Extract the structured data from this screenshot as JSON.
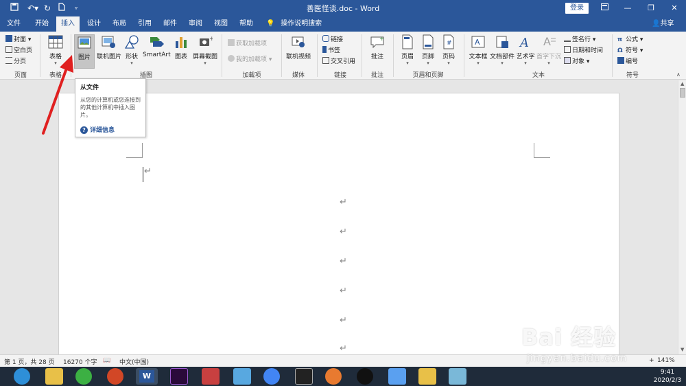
{
  "window": {
    "title": "善医怪谈.doc - Word",
    "login_label": "登录"
  },
  "tabs": [
    "文件",
    "开始",
    "插入",
    "设计",
    "布局",
    "引用",
    "邮件",
    "审阅",
    "视图",
    "帮助"
  ],
  "active_tab": "插入",
  "tellme": "操作说明搜索",
  "share": "共享",
  "ribbon": {
    "pages": {
      "cover": "封面",
      "blank": "空白页",
      "break": "分页",
      "label": "页面"
    },
    "tables": {
      "table": "表格",
      "label": "表格"
    },
    "illustrations": {
      "picture": "图片",
      "online_picture": "联机图片",
      "shapes": "形状",
      "smartart": "SmartArt",
      "chart": "图表",
      "screenshot": "屏幕截图",
      "label": "插图"
    },
    "addins": {
      "get": "获取加载项",
      "my": "我的加载项",
      "label": "加载项"
    },
    "media": {
      "online_video": "联机视频",
      "label": "媒体"
    },
    "links": {
      "link": "链接",
      "bookmark": "书签",
      "cross_ref": "交叉引用",
      "label": "链接"
    },
    "comments": {
      "comment": "批注",
      "label": "批注"
    },
    "header_footer": {
      "header": "页眉",
      "footer": "页脚",
      "page_number": "页码",
      "label": "页眉和页脚"
    },
    "text": {
      "textbox": "文本框",
      "quickparts": "文档部件",
      "wordart": "艺术字",
      "dropcap": "首字下沉",
      "signature": "签名行",
      "datetime": "日期和时间",
      "object": "对象",
      "label": "文本"
    },
    "symbols": {
      "equation": "公式",
      "symbol": "符号",
      "number": "编号",
      "label": "符号"
    }
  },
  "tooltip": {
    "title": "从文件",
    "body": "从您的计算机或您连接到的其他计算机中插入图片。",
    "more": "详细信息"
  },
  "status": {
    "page": "第 1 页，共 28 页",
    "words": "16270 个字",
    "lang": "中文(中国)",
    "zoom": "141%"
  },
  "taskbar": {
    "time": "9:41",
    "date": "2020/2/3"
  },
  "watermark": {
    "brand": "Bai 经验",
    "url": "jingyan.baidu.com"
  },
  "colors": {
    "accent": "#2b579a",
    "arrow": "#e02020"
  }
}
